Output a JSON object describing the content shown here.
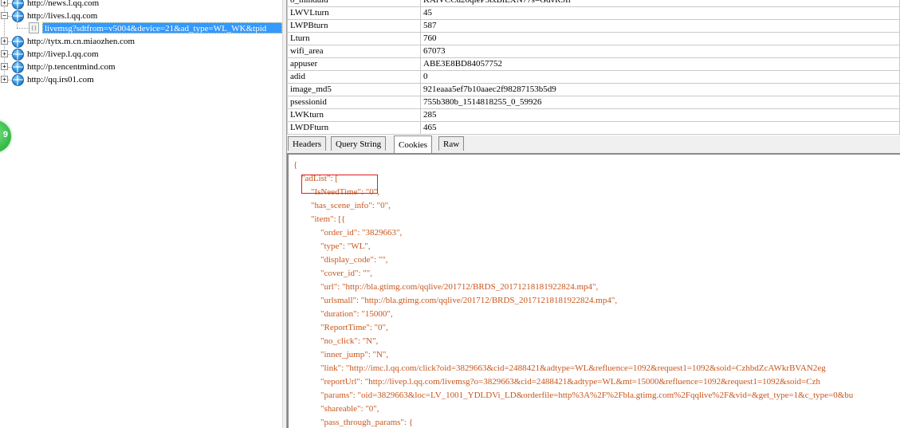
{
  "tree": {
    "hosts": [
      {
        "label": "http://news.l.qq.com",
        "expander": "+"
      },
      {
        "label": "http://lives.l.qq.com",
        "expander": "−"
      },
      {
        "label": "http://tytx.m.cn.miaozhen.com",
        "expander": "+"
      },
      {
        "label": "http://livep.l.qq.com",
        "expander": "+"
      },
      {
        "label": "http://p.tencentmind.com",
        "expander": "+"
      },
      {
        "label": "http://qq.irs01.com",
        "expander": "+"
      }
    ],
    "selected_request": "livemsg?sdtfrom=v5004&device=21&ad_type=WL_WK&tpid",
    "request_icon": "{}",
    "badge_text": "9"
  },
  "query_table": [
    {
      "key": "o_minduid",
      "value": "KAiVCCd20qieP3txBiEXN77s=GdvR9If"
    },
    {
      "key": "LWVLturn",
      "value": "45"
    },
    {
      "key": "LWPBturn",
      "value": "587"
    },
    {
      "key": "Lturn",
      "value": "760"
    },
    {
      "key": "wifi_area",
      "value": "67073"
    },
    {
      "key": "appuser",
      "value": "ABE3E8BD84057752"
    },
    {
      "key": "adid",
      "value": "0"
    },
    {
      "key": "image_md5",
      "value": "921eaaa5ef7b10aaec2f98287153b5d9"
    },
    {
      "key": "psessionid",
      "value": "755b380b_1514818255_0_59926"
    },
    {
      "key": "LWKturn",
      "value": "285"
    },
    {
      "key": "LWDFturn",
      "value": "465"
    }
  ],
  "tabs": [
    {
      "label": "Headers",
      "active": false
    },
    {
      "label": "Query String",
      "active": false
    },
    {
      "label": "Cookies",
      "active": true
    },
    {
      "label": "Raw",
      "active": false
    }
  ],
  "json_lines": [
    {
      "text": "{",
      "indent": 0
    },
    {
      "text": "\"adList\": [",
      "indent": 1
    },
    {
      "text": "\"IsNeedTime\": \"0\",",
      "indent": 2
    },
    {
      "text": "\"has_scene_info\": \"0\",",
      "indent": 2
    },
    {
      "text": "\"item\": [{",
      "indent": 2
    },
    {
      "text": "\"order_id\": \"3829663\",",
      "indent": 3
    },
    {
      "text": "\"type\": \"WL\",",
      "indent": 3
    },
    {
      "text": "\"display_code\": \"\",",
      "indent": 3
    },
    {
      "text": "\"cover_id\": \"\",",
      "indent": 3
    },
    {
      "text": "\"url\": \"http://bla.gtimg.com/qqlive/201712/BRDS_20171218181922824.mp4\",",
      "indent": 3
    },
    {
      "text": "\"urlsmall\": \"http://bla.gtimg.com/qqlive/201712/BRDS_20171218181922824.mp4\",",
      "indent": 3
    },
    {
      "text": "\"duration\": \"15000\",",
      "indent": 3
    },
    {
      "text": "\"ReportTime\": \"0\",",
      "indent": 3
    },
    {
      "text": "\"no_click\": \"N\",",
      "indent": 3
    },
    {
      "text": "\"inner_jump\": \"N\",",
      "indent": 3
    },
    {
      "text": "\"link\": \"http://imc.l.qq.com/click?oid=3829663&cid=2488421&adtype=WL&refluence=1092&request1=1092&soid=CzhbdZcAWkrBVAN2eg",
      "indent": 3
    },
    {
      "text": "\"reportUrl\": \"http://livep.l.qq.com/livemsg?o=3829663&cid=2488421&adtype=WL&mt=15000&refluence=1092&request1=1092&soid=Czh",
      "indent": 3
    },
    {
      "text": "\"params\": \"oid=3829663&loc=LV_1001_YDLDVi_LD&orderfile=http%3A%2F%2Fbla.gtimg.com%2Fqqlive%2F&vid=&get_type=1&c_type=0&bu",
      "indent": 3
    },
    {
      "text": "\"shareable\": \"0\",",
      "indent": 3
    },
    {
      "text": "\"pass_through_params\": {",
      "indent": 3
    }
  ],
  "colors": {
    "json_text": "#c8561c",
    "highlight_box": "#e31a1a",
    "selection": "#3399ff"
  }
}
